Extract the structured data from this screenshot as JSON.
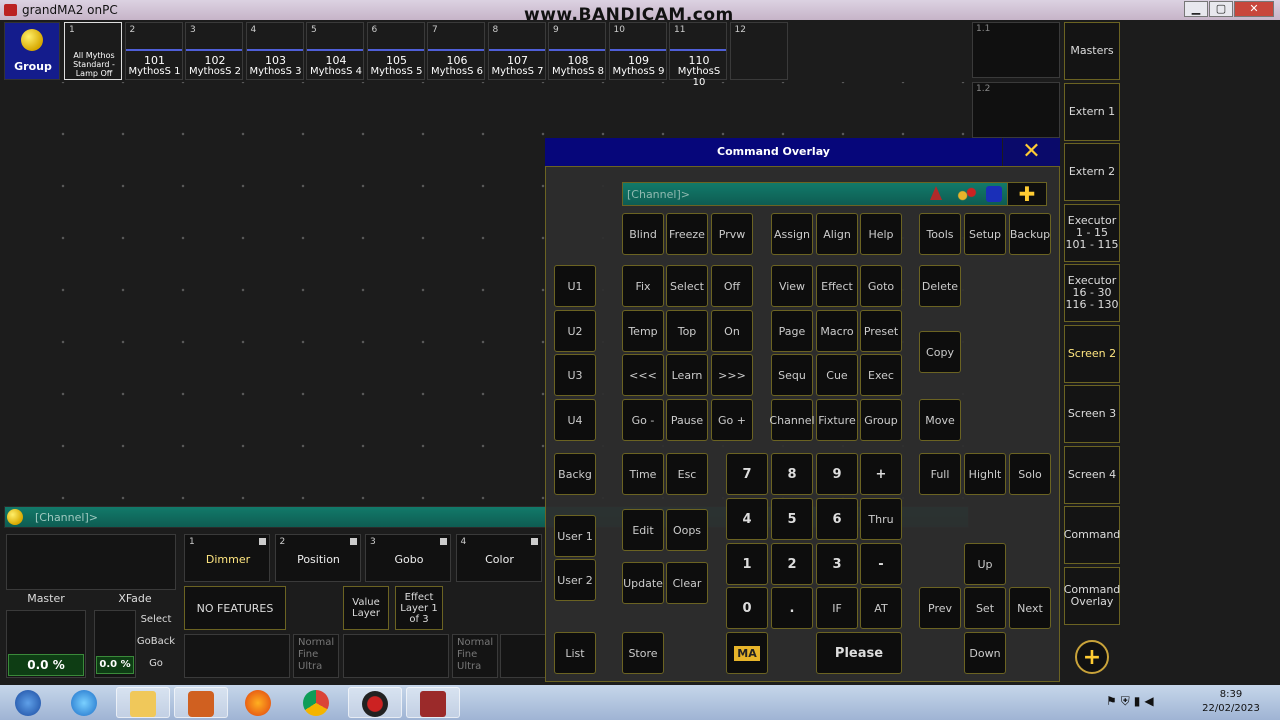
{
  "window": {
    "title": "grandMA2 onPC",
    "min": "▁",
    "max": "▢",
    "close": "✕"
  },
  "watermark": "www.BANDICAM.com",
  "group_pool": {
    "group_label": "Group",
    "cells": [
      {
        "num": "1",
        "line1": "All Mythos Standard - Lamp Off",
        "line2": ""
      },
      {
        "num": "2",
        "line1": "101",
        "line2": "MythosS 1"
      },
      {
        "num": "3",
        "line1": "102",
        "line2": "MythosS 2"
      },
      {
        "num": "4",
        "line1": "103",
        "line2": "MythosS 3"
      },
      {
        "num": "5",
        "line1": "104",
        "line2": "MythosS 4"
      },
      {
        "num": "6",
        "line1": "105",
        "line2": "MythosS 5"
      },
      {
        "num": "7",
        "line1": "106",
        "line2": "MythosS 6"
      },
      {
        "num": "8",
        "line1": "107",
        "line2": "MythosS 7"
      },
      {
        "num": "9",
        "line1": "108",
        "line2": "MythosS 8"
      },
      {
        "num": "10",
        "line1": "109",
        "line2": "MythosS 9"
      },
      {
        "num": "11",
        "line1": "110",
        "line2": "MythosS 10"
      },
      {
        "num": "12",
        "line1": "",
        "line2": ""
      }
    ]
  },
  "views": [
    "1.1",
    "1.2"
  ],
  "right_bar": [
    "Masters",
    "Extern 1",
    "Extern 2",
    "Executor 1 - 15 101 - 115",
    "Executor 16 - 30 116 - 130",
    "Screen 2",
    "Screen 3",
    "Screen 4",
    "Command",
    "Command Overlay"
  ],
  "command_line": {
    "text": "[Channel]>"
  },
  "bottom": {
    "features": [
      {
        "num": "1",
        "label": "Dimmer"
      },
      {
        "num": "2",
        "label": "Position"
      },
      {
        "num": "3",
        "label": "Gobo"
      },
      {
        "num": "4",
        "label": "Color"
      }
    ],
    "no_features": "NO FEATURES",
    "value_layer": "Value Layer",
    "effect_layer": "Effect Layer 1 of 3",
    "normal1": "Normal Fine Ultra",
    "normal2": "Normal Fine Ultra",
    "master_label": "Master",
    "master_value": "0.0 %",
    "xfade_label": "XFade",
    "xfade_value": "0.0 %",
    "select": "Select",
    "goback": "GoBack",
    "go": "Go"
  },
  "overlay": {
    "title": "Command Overlay",
    "close": "✕",
    "input_text": "[Channel]>",
    "plus": "✚",
    "keys": {
      "u1": "U1",
      "u2": "U2",
      "u3": "U3",
      "u4": "U4",
      "backg": "Backg",
      "user1": "User 1",
      "user2": "User 2",
      "list": "List",
      "blind": "Blind",
      "freeze": "Freeze",
      "prvw": "Prvw",
      "fix": "Fix",
      "select": "Select",
      "off": "Off",
      "temp": "Temp",
      "top": "Top",
      "on": "On",
      "prev3": "<<<",
      "learn": "Learn",
      "next3": ">>>",
      "gominus": "Go -",
      "pause": "Pause",
      "goplus": "Go +",
      "time": "Time",
      "esc": "Esc",
      "edit": "Edit",
      "oops": "Oops",
      "update": "Update",
      "clear": "Clear",
      "store": "Store",
      "assign": "Assign",
      "align": "Align",
      "help": "Help",
      "view": "View",
      "effect": "Effect",
      "goto": "Goto",
      "page": "Page",
      "macro": "Macro",
      "preset": "Preset",
      "sequ": "Sequ",
      "cue": "Cue",
      "exec": "Exec",
      "channel": "Channel",
      "fixture": "Fixture",
      "group": "Group",
      "d7": "7",
      "d8": "8",
      "d9": "9",
      "plus": "+",
      "d4": "4",
      "d5": "5",
      "d6": "6",
      "thru": "Thru",
      "d1": "1",
      "d2": "2",
      "d3": "3",
      "minus": "-",
      "d0": "0",
      "dot": ".",
      "if": "IF",
      "at": "AT",
      "ma": "MA",
      "please": "Please",
      "tools": "Tools",
      "setup": "Setup",
      "backup": "Backup",
      "delete": "Delete",
      "copy": "Copy",
      "move": "Move",
      "full": "Full",
      "highlt": "Highlt",
      "solo": "Solo",
      "up": "Up",
      "prev": "Prev",
      "set": "Set",
      "next": "Next",
      "down": "Down"
    }
  },
  "taskbar": {
    "time": "8:39",
    "date": "22/02/2023"
  }
}
